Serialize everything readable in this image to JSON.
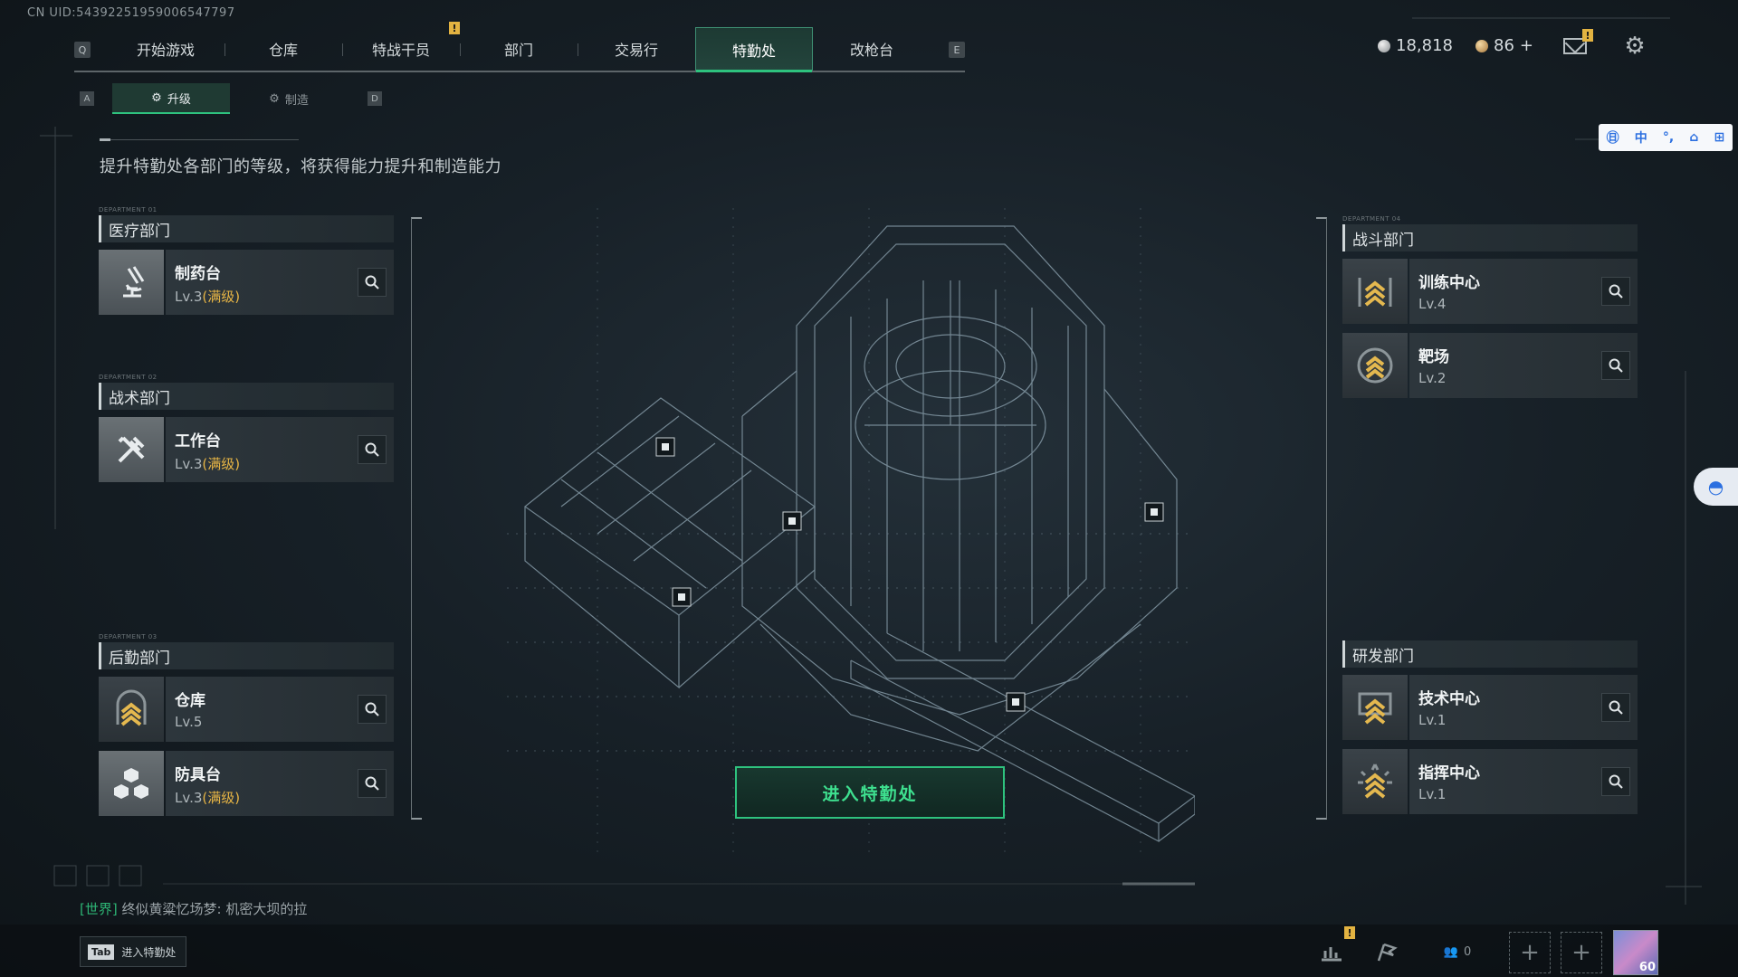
{
  "uid": "CN UID:5439225195900654779​7",
  "nav": {
    "key_left": "Q",
    "key_right": "E",
    "tabs": [
      {
        "label": "开始游戏",
        "active": false,
        "alert": false
      },
      {
        "label": "仓库",
        "active": false,
        "alert": false
      },
      {
        "label": "特战干员",
        "active": false,
        "alert": true
      },
      {
        "label": "部门",
        "active": false,
        "alert": false
      },
      {
        "label": "交易行",
        "active": false,
        "alert": false
      },
      {
        "label": "特勤处",
        "active": true,
        "alert": false
      },
      {
        "label": "改枪台",
        "active": false,
        "alert": false
      }
    ]
  },
  "currency": {
    "silver": "18,818",
    "gold": "86",
    "gold_add": "+"
  },
  "subnav": {
    "key_left": "A",
    "key_right": "D",
    "tabs": [
      {
        "label": "升级",
        "active": true
      },
      {
        "label": "制造",
        "active": false
      }
    ]
  },
  "description": "提升特勤处各部门的等级，将获得能力提升和制造能力",
  "departments": {
    "medical": {
      "tag": "DEPARTMENT 01",
      "title": "医疗部门",
      "facilities": [
        {
          "name": "制药台",
          "level": "Lv.3",
          "max": "(满级)",
          "icon": "microscope-icon"
        }
      ]
    },
    "tactical": {
      "tag": "DEPARTMENT 02",
      "title": "战术部门",
      "facilities": [
        {
          "name": "工作台",
          "level": "Lv.3",
          "max": "(满级)",
          "icon": "tools-icon"
        }
      ]
    },
    "logistics": {
      "tag": "DEPARTMENT 03",
      "title": "后勤部门",
      "facilities": [
        {
          "name": "仓库",
          "level": "Lv.5",
          "max": "",
          "icon": "rank-chevron-icon"
        },
        {
          "name": "防具台",
          "level": "Lv.3",
          "max": "(满级)",
          "icon": "cubes-icon"
        }
      ]
    },
    "combat": {
      "tag": "DEPARTMENT 04",
      "title": "战斗部门",
      "facilities": [
        {
          "name": "训练中心",
          "level": "Lv.4",
          "max": "",
          "icon": "rank-chevron-icon"
        },
        {
          "name": "靶场",
          "level": "Lv.2",
          "max": "",
          "icon": "rank-chevron-icon"
        }
      ]
    },
    "research": {
      "title": "研发部门",
      "facilities": [
        {
          "name": "技术中心",
          "level": "Lv.1",
          "max": "",
          "icon": "rank-chevron-icon"
        },
        {
          "name": "指挥中心",
          "level": "Lv.1",
          "max": "",
          "icon": "rank-chevron-icon"
        }
      ]
    }
  },
  "enter_button": "进入特勤处",
  "ime": {
    "chinese": "中"
  },
  "chat": {
    "channel": "[世界]",
    "message": "终似黄粱忆场梦: 机密大坝的拉"
  },
  "bottom": {
    "tab_key": "Tab",
    "tab_label": "进入特勤处",
    "friends_count": "0",
    "avatar_level": "60"
  },
  "colors": {
    "accent": "#2ec27e",
    "max_level": "#e7b545",
    "alert": "#e3b341"
  }
}
